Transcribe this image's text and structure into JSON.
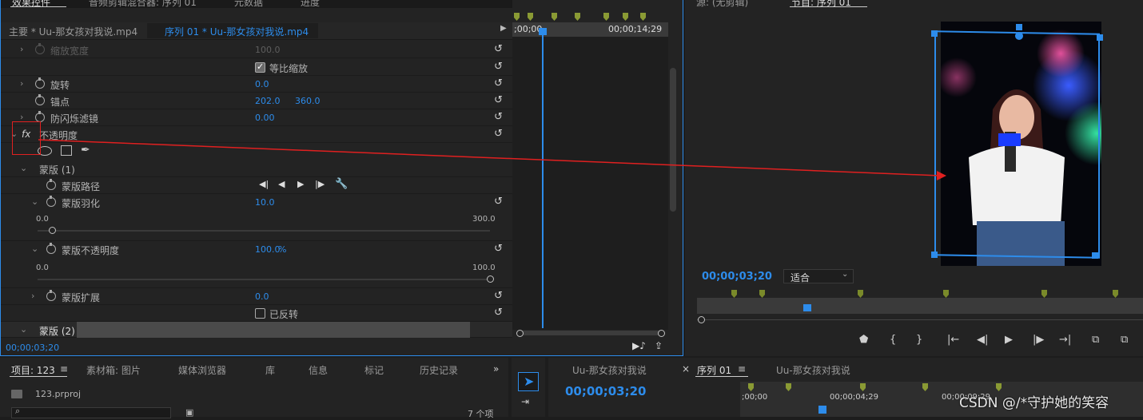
{
  "effect_controls": {
    "tabs": [
      "效果控件",
      "音频剪辑混合器: 序列 01",
      "元数据",
      "进度"
    ],
    "clip_master": "主要 * Uu-那女孩对我说.mp4",
    "clip_sequence": "序列 01 * Uu-那女孩对我说.mp4",
    "tl_start": ";00;00",
    "tl_end": "00;00;14;29",
    "props": {
      "scale_width_label": "缩放宽度",
      "scale_width_value": "100.0",
      "uniform_scale_label": "等比缩放",
      "rotation_label": "旋转",
      "rotation_value": "0.0",
      "anchor_label": "锚点",
      "anchor_x": "202.0",
      "anchor_y": "360.0",
      "antiflicker_label": "防闪烁滤镜",
      "antiflicker_value": "0.00",
      "opacity_label": "不透明度",
      "fx_icon": "fx",
      "mask1_label": "蒙版 (1)",
      "mask_path_label": "蒙版路径",
      "mask_feather_label": "蒙版羽化",
      "mask_feather_value": "10.0",
      "feather_min": "0.0",
      "feather_max": "300.0",
      "feather_fraction": 0.033,
      "mask_opacity_label": "蒙版不透明度",
      "mask_opacity_value": "100.0",
      "mask_opacity_unit": "%",
      "mask_opacity_min": "0.0",
      "mask_opacity_max": "100.0",
      "mask_opacity_fraction": 1.0,
      "mask_expand_label": "蒙版扩展",
      "mask_expand_value": "0.0",
      "inverted_label": "已反转",
      "mask2_label": "蒙版 (2)"
    },
    "footer_time": "00;00;03;20"
  },
  "program_monitor": {
    "tabs": [
      "源: (无剪辑)",
      "节目: 序列 01"
    ],
    "timecode": "00;00;03;20",
    "fit_label": "适合"
  },
  "project": {
    "tabs": [
      "项目: 123",
      "素材箱: 图片",
      "媒体浏览器",
      "库",
      "信息",
      "标记",
      "历史记录"
    ],
    "file_name": "123.prproj",
    "item_count": "7 个项"
  },
  "timeline": {
    "tabs": [
      "Uu-那女孩对我说",
      "序列 01",
      "Uu-那女孩对我说"
    ],
    "timecode": "00;00;03;20",
    "ruler_start": ";00;00",
    "ruler_mid": "00;00;04;29",
    "ruler_end": "00;00;09;29"
  },
  "watermark": "CSDN @/*守护她的笑容",
  "colors": {
    "accent": "#2d8ceb",
    "marker": "#7a8a2a",
    "annotation": "#e02020"
  }
}
